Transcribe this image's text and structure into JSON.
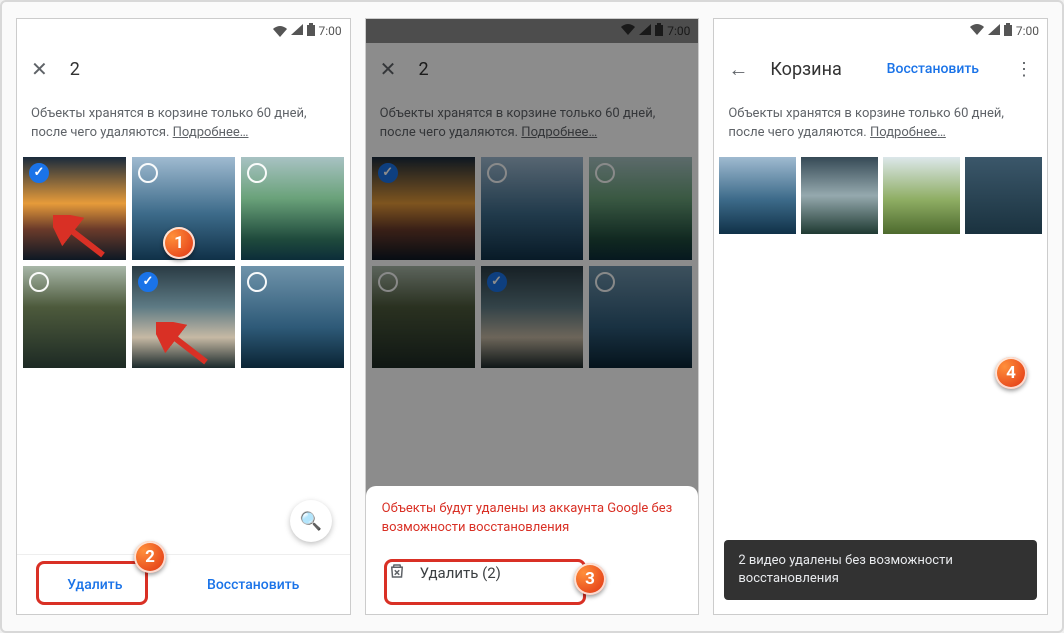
{
  "status": {
    "time": "7:00"
  },
  "screen1": {
    "selected_count": "2",
    "info_text": "Объекты хранятся в корзине только 60 дней, после чего удаляются.",
    "learn_more": "Подробнее…",
    "delete_label": "Удалить",
    "restore_label": "Восстановить",
    "zoom_icon": "⊕",
    "thumbs": [
      {
        "class": "sun",
        "name": "sunset",
        "selected": true
      },
      {
        "class": "lake",
        "name": "lake-boat",
        "selected": false
      },
      {
        "class": "green",
        "name": "green-lake",
        "selected": false
      },
      {
        "class": "stream",
        "name": "stream-valley",
        "selected": false
      },
      {
        "class": "falls",
        "name": "waterfall",
        "selected": true
      },
      {
        "class": "boats",
        "name": "sailboats",
        "selected": false
      }
    ]
  },
  "screen2": {
    "selected_count": "2",
    "info_text": "Объекты хранятся в корзине только 60 дней, после чего удаляются.",
    "learn_more": "Подробнее…",
    "sheet_warning": "Объекты будут удалены из аккаунта Google без возможности восстановления",
    "sheet_delete": "Удалить (2)",
    "thumbs": [
      {
        "class": "sun",
        "selected": true
      },
      {
        "class": "lake",
        "selected": false
      },
      {
        "class": "green",
        "selected": false
      },
      {
        "class": "stream",
        "selected": false
      },
      {
        "class": "falls",
        "selected": true
      },
      {
        "class": "boats",
        "selected": false
      }
    ]
  },
  "screen3": {
    "title": "Корзина",
    "restore_label": "Восстановить",
    "info_text": "Объекты хранятся в корзине только 60 дней, после чего удаляются.",
    "learn_more": "Подробнее…",
    "thumbs": [
      {
        "class": "lake"
      },
      {
        "class": "clouds"
      },
      {
        "class": "field"
      },
      {
        "class": "pier"
      }
    ],
    "toast_text": "2 видео удалены без возможности восстановления"
  },
  "markers": {
    "m1": "1",
    "m2": "2",
    "m3": "3",
    "m4": "4"
  }
}
